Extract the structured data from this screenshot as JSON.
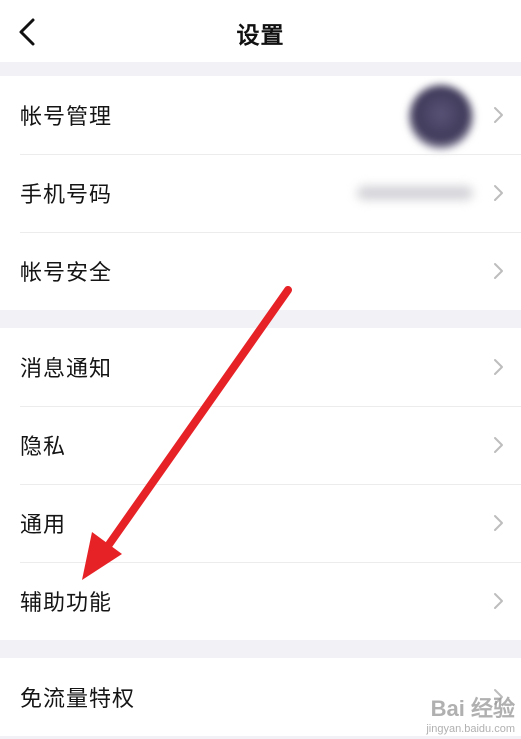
{
  "nav": {
    "title": "设置"
  },
  "groups": [
    {
      "items": [
        {
          "label": "帐号管理"
        },
        {
          "label": "手机号码"
        },
        {
          "label": "帐号安全"
        }
      ]
    },
    {
      "items": [
        {
          "label": "消息通知"
        },
        {
          "label": "隐私"
        },
        {
          "label": "通用"
        },
        {
          "label": "辅助功能"
        }
      ]
    },
    {
      "items": [
        {
          "label": "免流量特权"
        }
      ]
    }
  ],
  "icons": {
    "back": "chevron-left-icon",
    "row_chevron": "chevron-right-icon"
  },
  "colors": {
    "background": "#f2f2f6",
    "card": "#ffffff",
    "chevron": "#bdbdbd",
    "annotation_arrow": "#e62227"
  },
  "watermark": {
    "logo": "Bai 经验",
    "sub": "jingyan.baidu.com"
  }
}
